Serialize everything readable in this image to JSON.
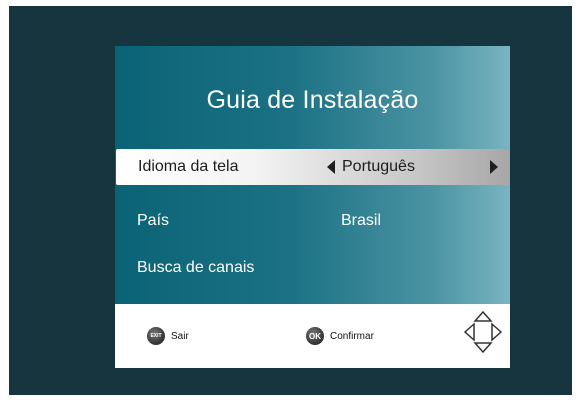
{
  "dialog": {
    "title": "Guia de Instalação"
  },
  "menu": {
    "items": [
      {
        "label": "Idioma da tela",
        "value": "Português",
        "selected": true
      },
      {
        "label": "País",
        "value": "Brasil",
        "selected": false
      },
      {
        "label": "Busca de canais",
        "value": "",
        "selected": false
      }
    ]
  },
  "footer": {
    "exit_badge": "EXIT",
    "exit_label": "Sair",
    "ok_badge": "OK",
    "ok_label": "Confirmar",
    "nav_icon": "dpad-arrows-icon"
  },
  "colors": {
    "background": "#17353e",
    "panel_start": "#0a6375",
    "panel_end": "#7ab4c0",
    "text": "#ffffff"
  }
}
